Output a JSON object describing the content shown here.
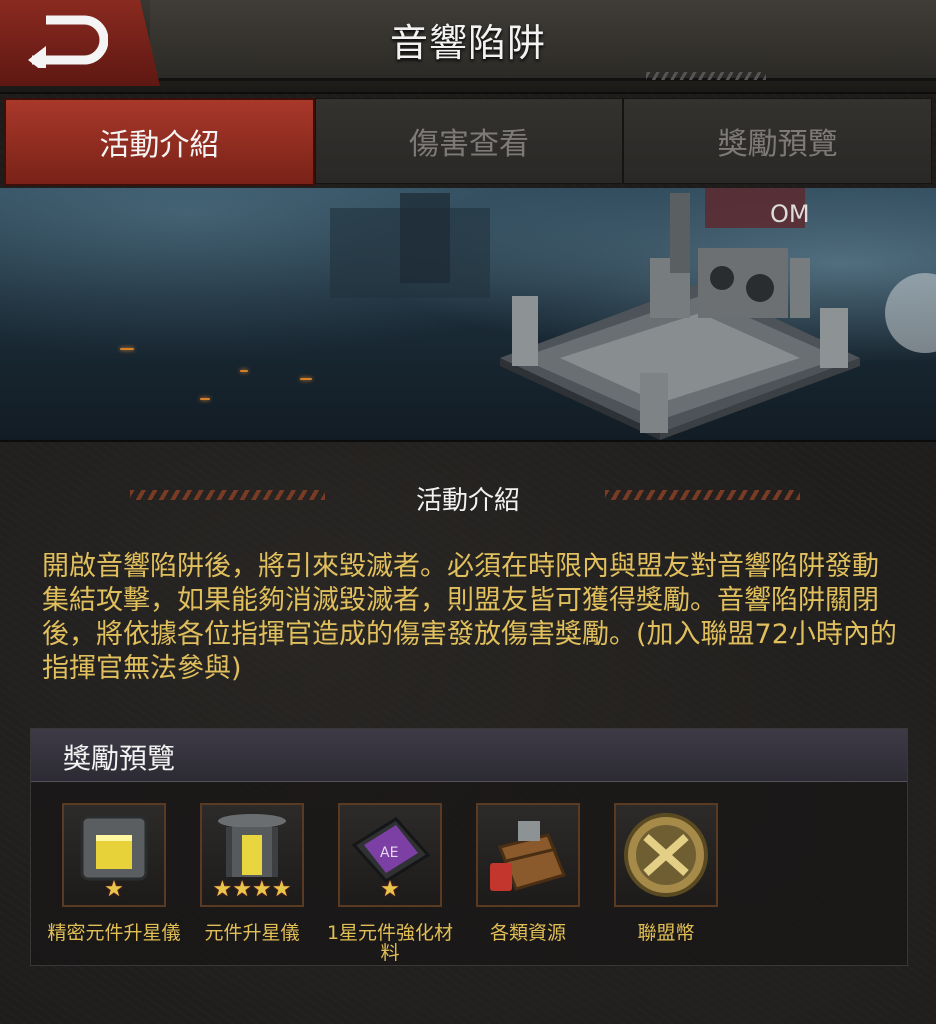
{
  "header": {
    "title": "音響陷阱"
  },
  "tabs": [
    {
      "label": "活動介紹",
      "active": true
    },
    {
      "label": "傷害查看",
      "active": false
    },
    {
      "label": "獎勵預覽",
      "active": false
    }
  ],
  "section": {
    "title": "活動介紹",
    "description": "開啟音響陷阱後，將引來毀滅者。必須在時限內與盟友對音響陷阱發動集結攻擊，如果能夠消滅毀滅者，則盟友皆可獲得獎勵。音響陷阱關閉後，將依據各位指揮官造成的傷害發放傷害獎勵。(加入聯盟72小時內的指揮官無法參與)"
  },
  "rewards": {
    "title": "獎勵預覽",
    "items": [
      {
        "label": "精密元件升星儀",
        "icon": "precision-star-device-icon",
        "stars": 1
      },
      {
        "label": "元件升星儀",
        "icon": "star-device-icon",
        "stars": 4
      },
      {
        "label": "1星元件強化材料",
        "icon": "chip-material-icon",
        "stars": 1
      },
      {
        "label": "各類資源",
        "icon": "resource-crate-icon",
        "stars": 0
      },
      {
        "label": "聯盟幣",
        "icon": "alliance-coin-icon",
        "stars": 0
      }
    ]
  },
  "colors": {
    "accent": "#a8382a",
    "text_gold": "#e0bf5c",
    "label_gold": "#e2bf55"
  }
}
